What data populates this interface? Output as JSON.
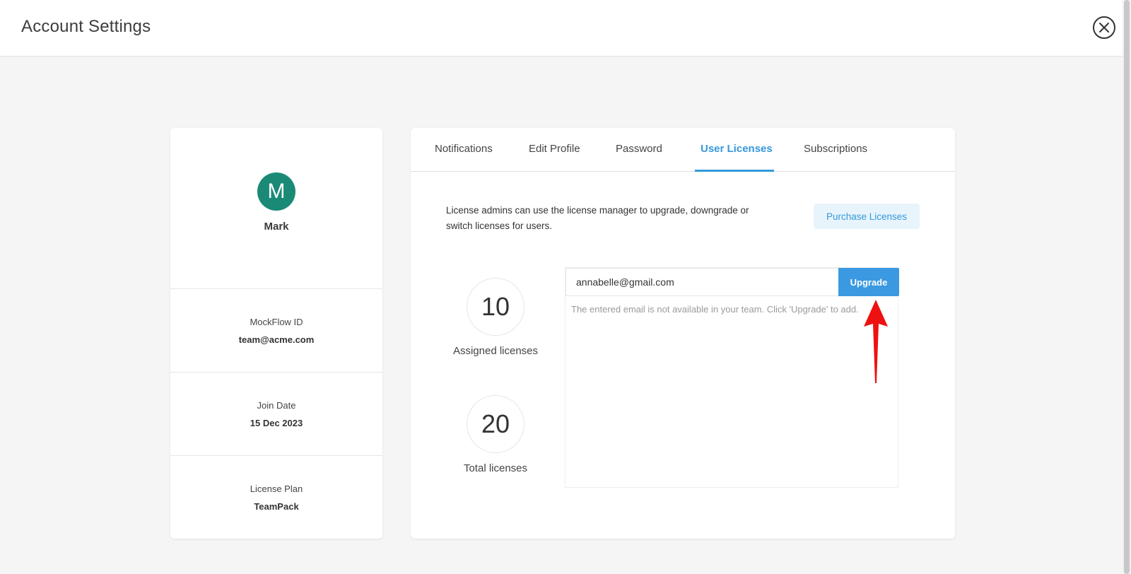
{
  "header": {
    "title": "Account Settings",
    "close_icon": "close-circle-icon"
  },
  "profile": {
    "avatar_letter": "M",
    "avatar_color": "#1a8a77",
    "name": "Mark",
    "fields": [
      {
        "label": "MockFlow ID",
        "value": "team@acme.com"
      },
      {
        "label": "Join Date",
        "value": "15 Dec 2023"
      },
      {
        "label": "License Plan",
        "value": "TeamPack"
      }
    ]
  },
  "tabs": [
    {
      "label": "Notifications",
      "active": false
    },
    {
      "label": "Edit Profile",
      "active": false
    },
    {
      "label": "Password",
      "active": false
    },
    {
      "label": "User Licenses",
      "active": true
    },
    {
      "label": "Subscriptions",
      "active": false
    }
  ],
  "licenses": {
    "description": "License admins can use the license manager to upgrade, downgrade or switch licenses for users.",
    "purchase_label": "Purchase Licenses",
    "assigned": {
      "value": "10",
      "label": "Assigned licenses"
    },
    "total": {
      "value": "20",
      "label": "Total licenses"
    },
    "email_value": "annabelle@gmail.com",
    "upgrade_label": "Upgrade",
    "hint": "The entered email is not available in your team. Click 'Upgrade' to add."
  },
  "colors": {
    "accent": "#3498db",
    "upgrade_button": "#3a99e0",
    "annotation_arrow": "#ee1111"
  }
}
